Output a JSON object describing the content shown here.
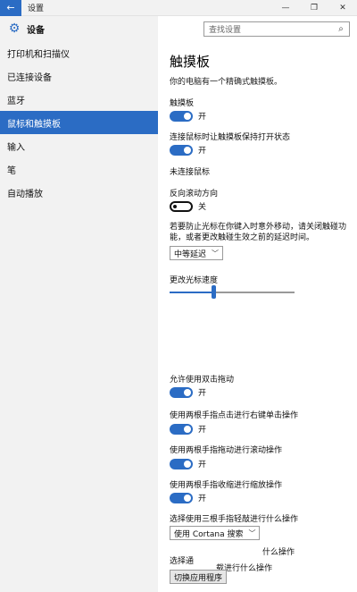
{
  "window": {
    "title": "设置",
    "back_icon": "back-arrow-icon",
    "minimize": "—",
    "maximize": "❐",
    "close": "✕"
  },
  "sidebar": {
    "header": "设备",
    "items": [
      {
        "label": "打印机和扫描仪",
        "active": false
      },
      {
        "label": "已连接设备",
        "active": false
      },
      {
        "label": "蓝牙",
        "active": false
      },
      {
        "label": "鼠标和触摸板",
        "active": true
      },
      {
        "label": "输入",
        "active": false
      },
      {
        "label": "笔",
        "active": false
      },
      {
        "label": "自动播放",
        "active": false
      }
    ]
  },
  "search": {
    "placeholder": "查找设置"
  },
  "main": {
    "title": "触摸板",
    "subtitle": "你的电脑有一个精确式触摸板。",
    "touchpad": {
      "label": "触摸板",
      "state": "开"
    },
    "keep_on_mouse": {
      "label": "连接鼠标时让触摸板保持打开状态",
      "state": "开"
    },
    "no_mouse": "未连接鼠标",
    "reverse_scroll": {
      "label": "反向滚动方向",
      "state": "关"
    },
    "delay_desc": "若要防止光标在你键入时意外移动，请关闭触碰功能，或者更改触碰生效之前的延迟时间。",
    "delay_select": "中等延迟",
    "cursor_speed_label": "更改光标速度",
    "cursor_speed_value": 0.35,
    "double_tap_drag": {
      "label": "允许使用双击拖动",
      "state": "开"
    },
    "two_finger_right_click": {
      "label": "使用两根手指点击进行右键单击操作",
      "state": "开"
    },
    "two_finger_scroll": {
      "label": "使用两根手指拖动进行滚动操作",
      "state": "开"
    },
    "two_finger_zoom": {
      "label": "使用两根手指收缩进行缩放操作",
      "state": "开"
    },
    "three_finger_tap_label": "选择使用三根手指轻敲进行什么操作",
    "three_finger_tap_select": "使用 Cortana 搜索",
    "three_finger_swipe_fragment": "什么操作",
    "select_partial_label": "选择通",
    "four_finger_fragment": "载进行什么操作",
    "switch_app_button": "切换应用程序"
  },
  "colors": {
    "accent": "#2b6cc4",
    "sidebar_bg": "#f2f2f2"
  }
}
